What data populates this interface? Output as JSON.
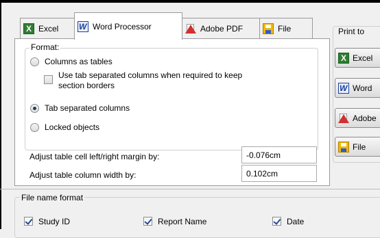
{
  "tabs": [
    {
      "label": "Excel",
      "icon": "excel-icon",
      "active": false
    },
    {
      "label": "Word Processor",
      "icon": "word-icon",
      "active": true
    },
    {
      "label": "Adobe PDF",
      "icon": "pdf-icon",
      "active": false
    },
    {
      "label": "File",
      "icon": "floppy-icon",
      "active": false
    }
  ],
  "format": {
    "title": "Format:",
    "options": [
      {
        "label": "Columns as tables",
        "checked": false
      },
      {
        "label": "Tab separated columns",
        "checked": true
      },
      {
        "label": "Locked objects",
        "checked": false
      }
    ],
    "tab_columns_checkbox": {
      "label_line1": "Use tab separated columns when required to keep",
      "label_line2": "section borders",
      "checked": false
    }
  },
  "margins": {
    "cell_margin_label": "Adjust table cell left/right margin by:",
    "cell_margin_value": "-0.076cm",
    "column_width_label": "Adjust table column width by:",
    "column_width_value": "0.102cm"
  },
  "print_to": {
    "title": "Print to",
    "buttons": [
      {
        "label": "Excel",
        "icon": "excel-icon"
      },
      {
        "label": "Word",
        "icon": "word-icon"
      },
      {
        "label": "Adobe",
        "icon": "pdf-icon"
      },
      {
        "label": "File",
        "icon": "floppy-icon"
      }
    ]
  },
  "file_name_format": {
    "title": "File name format",
    "options": [
      {
        "label": "Study ID",
        "checked": true
      },
      {
        "label": "Report Name",
        "checked": true
      },
      {
        "label": "Date",
        "checked": true
      }
    ]
  }
}
